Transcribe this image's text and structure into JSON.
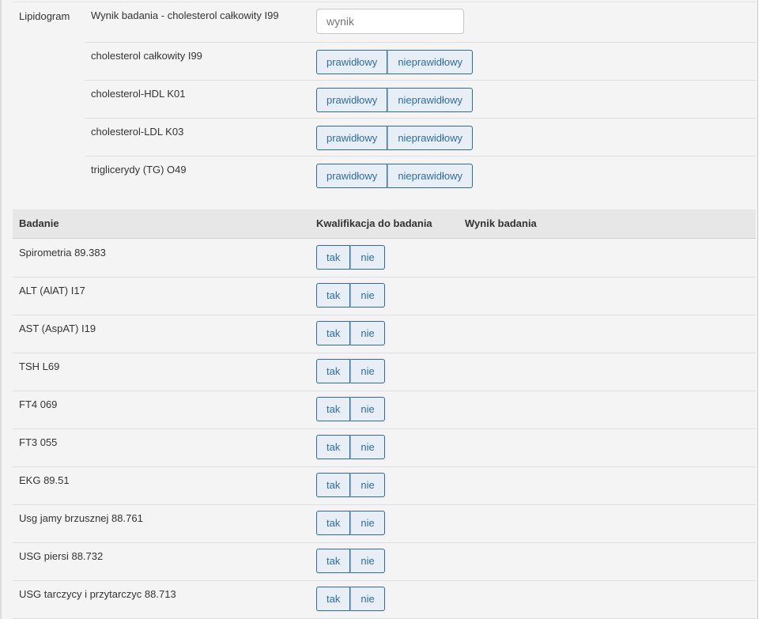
{
  "lipidogram": {
    "section_label": "Lipidogram",
    "result_row": {
      "label": "Wynik badania - cholesterol całkowity I99",
      "placeholder": "wynik"
    },
    "choice_labels": {
      "normal": "prawidłowy",
      "abnormal": "nieprawidłowy"
    },
    "rows": [
      {
        "label": "cholesterol całkowity I99"
      },
      {
        "label": "cholesterol-HDL K01"
      },
      {
        "label": "cholesterol-LDL K03"
      },
      {
        "label": "triglicerydy (TG) O49"
      }
    ]
  },
  "table": {
    "headers": {
      "exam": "Badanie",
      "qualification": "Kwalifikacja do badania",
      "result": "Wynik badania"
    },
    "choice_labels": {
      "yes": "tak",
      "no": "nie"
    },
    "rows": [
      {
        "label": "Spirometria 89.383"
      },
      {
        "label": "ALT (AlAT) I17"
      },
      {
        "label": "AST (AspAT) I19"
      },
      {
        "label": "TSH L69"
      },
      {
        "label": "FT4 069"
      },
      {
        "label": "FT3 055"
      },
      {
        "label": "EKG 89.51"
      },
      {
        "label": "Usg jamy brzusznej 88.761"
      },
      {
        "label": "USG piersi 88.732"
      },
      {
        "label": "USG tarczycy i przytarczyc 88.713"
      }
    ]
  }
}
